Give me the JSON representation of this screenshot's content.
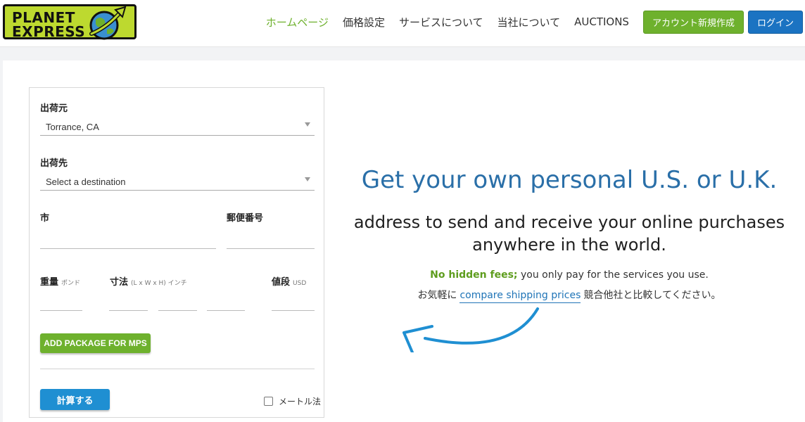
{
  "brand": {
    "logo_line1": "PLANET",
    "logo_line2": "EXPRESS",
    "logo_color": "#bdd92f"
  },
  "nav": {
    "items": [
      {
        "label": "ホームページ",
        "active": true
      },
      {
        "label": "価格設定",
        "active": false
      },
      {
        "label": "サービスについて",
        "active": false
      },
      {
        "label": "当社について",
        "active": false
      },
      {
        "label": "AUCTIONS",
        "active": false
      }
    ],
    "signup_label": "アカウント新規作成",
    "login_label": "ログイン"
  },
  "calculator": {
    "origin_label": "出荷元",
    "origin_value": "Torrance, CA",
    "destination_label": "出荷先",
    "destination_value": "Select a destination",
    "city_label": "市",
    "postal_label": "郵便番号",
    "weight_label": "重量",
    "weight_unit": "ポンド",
    "dimensions_label": "寸法",
    "dimensions_unit": "(L x W x H) インチ",
    "value_label": "値段",
    "value_unit": "USD",
    "add_package_label": "ADD PACKAGE FOR MPS",
    "calculate_label": "計算する",
    "metric_label": "メートル法",
    "metric_checked": false
  },
  "promo": {
    "title": "Get your own personal U.S. or U.K.",
    "subtitle": "address to send and receive your online purchases anywhere in the world.",
    "no_fees": "No hidden fees;",
    "no_fees_rest": " you only pay for the services you use.",
    "compare_prefix": "お気軽に",
    "compare_link": "compare shipping prices",
    "compare_suffix": "競合他社と比較してください。"
  },
  "colors": {
    "green": "#6eb12d",
    "blue": "#1b73c2",
    "title_blue": "#2a6fa8",
    "link_blue": "#1f74b7"
  }
}
